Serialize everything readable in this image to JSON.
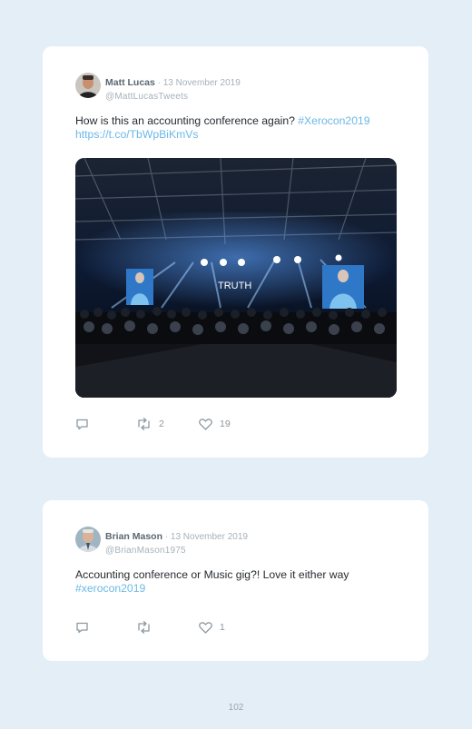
{
  "tweets": [
    {
      "name": "Matt Lucas",
      "date": " · 13 November 2019",
      "handle": "@MattLucasTweets",
      "text_main": "How is this an accounting conference again? ",
      "hashtag": "#Xerocon2019",
      "url": "https://t.co/TbWpBiKmVs",
      "image_stage_text": "TRUTH",
      "actions": {
        "reply": "",
        "retweets": "2",
        "likes": "19"
      }
    },
    {
      "name": "Brian Mason",
      "date": " · 13 November 2019",
      "handle": "@BrianMason1975",
      "text_main": "Accounting conference or Music gig?! Love it either way",
      "hashtag": "#xerocon2019",
      "actions": {
        "reply": "",
        "retweets": "",
        "likes": "1"
      }
    }
  ],
  "page": {
    "number": "102"
  },
  "colors": {
    "background": "#e3eef7",
    "card": "#ffffff",
    "link": "#6cb8e6",
    "name": "#5b6670",
    "muted": "#a7b1ba"
  },
  "icons": {
    "reply": "reply-icon",
    "retweet": "retweet-icon",
    "like": "heart-icon"
  }
}
